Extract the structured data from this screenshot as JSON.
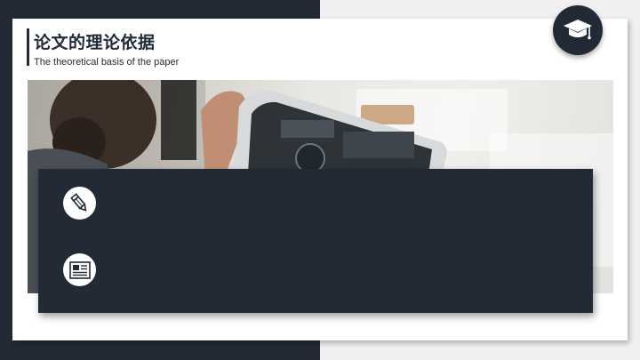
{
  "slide": {
    "title": "论文的理论依据",
    "subtitle": "The theoretical basis of the paper"
  },
  "icons": {
    "badge": "graduation-cap-icon",
    "item_1": "pencil-icon",
    "item_2": "newspaper-icon"
  },
  "colors": {
    "dark": "#222a35",
    "light_background": "#f1eff1",
    "card": "#ffffff"
  }
}
